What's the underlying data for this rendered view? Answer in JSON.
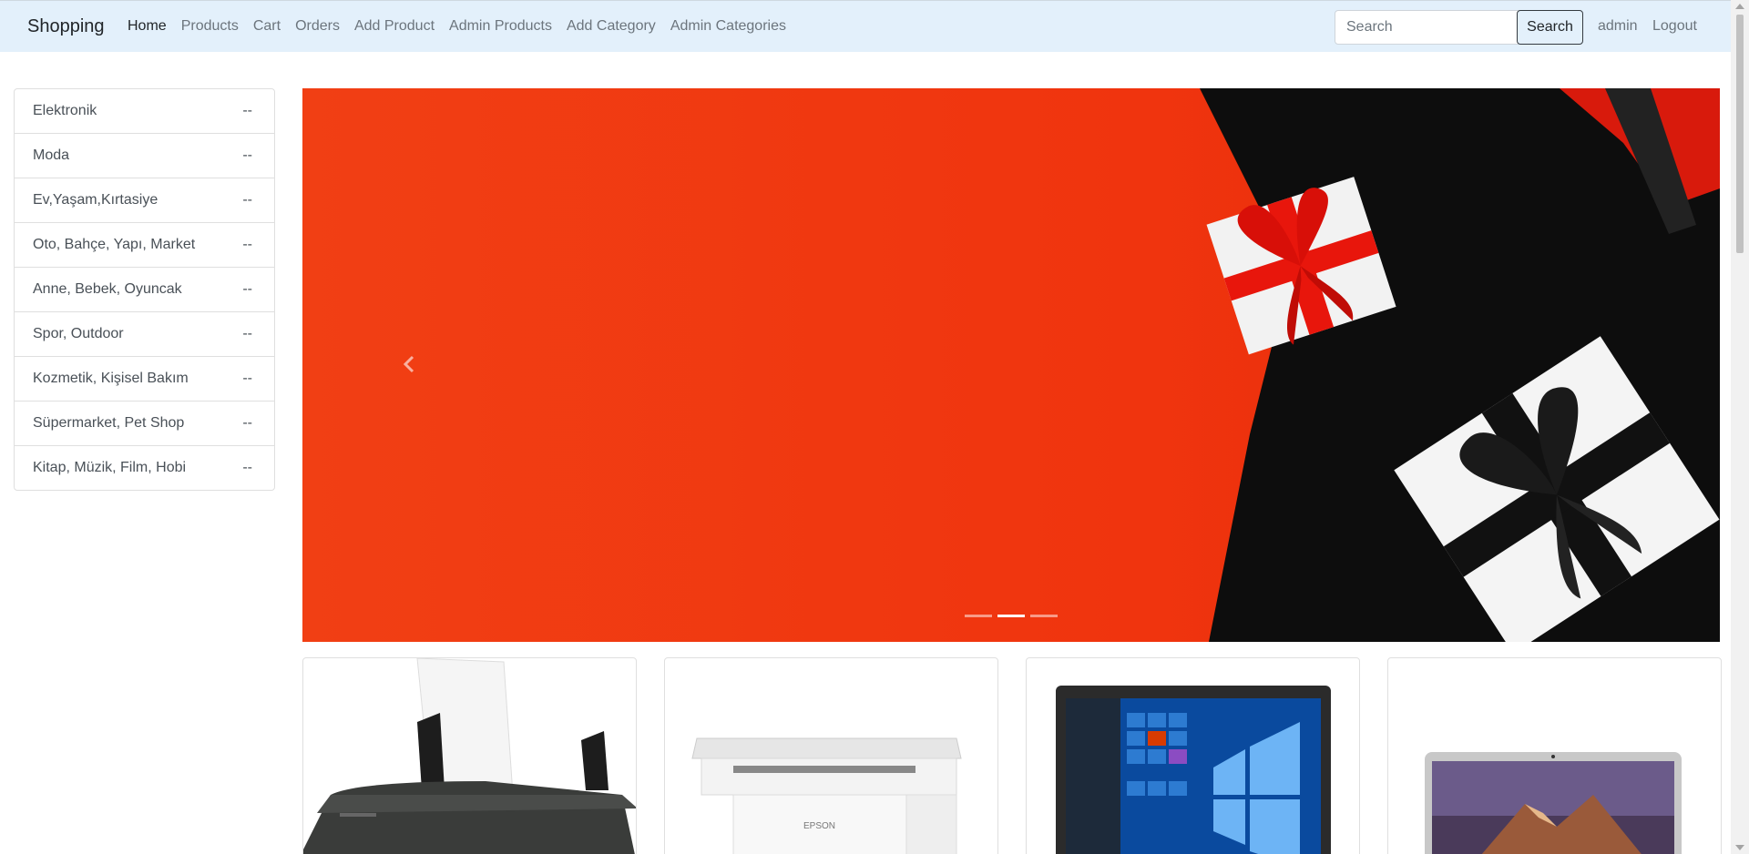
{
  "navbar": {
    "brand": "Shopping",
    "links": [
      {
        "label": "Home",
        "active": true
      },
      {
        "label": "Products",
        "active": false
      },
      {
        "label": "Cart",
        "active": false
      },
      {
        "label": "Orders",
        "active": false
      },
      {
        "label": "Add Product",
        "active": false
      },
      {
        "label": "Admin Products",
        "active": false
      },
      {
        "label": "Add Category",
        "active": false
      },
      {
        "label": "Admin Categories",
        "active": false
      }
    ],
    "search_placeholder": "Search",
    "search_button": "Search",
    "user": "admin",
    "logout": "Logout"
  },
  "categories": [
    {
      "name": "Elektronik",
      "badge": "--"
    },
    {
      "name": "Moda",
      "badge": "--"
    },
    {
      "name": "Ev,Yaşam,Kırtasiye",
      "badge": "--"
    },
    {
      "name": "Oto, Bahçe, Yapı, Market",
      "badge": "--"
    },
    {
      "name": "Anne, Bebek, Oyuncak",
      "badge": "--"
    },
    {
      "name": "Spor, Outdoor",
      "badge": "--"
    },
    {
      "name": "Kozmetik, Kişisel Bakım",
      "badge": "--"
    },
    {
      "name": "Süpermarket, Pet Shop",
      "badge": "--"
    },
    {
      "name": "Kitap, Müzik, Film, Hobi",
      "badge": "--"
    }
  ],
  "carousel": {
    "slide_count": 3,
    "active_index": 1,
    "prev_icon": "chevron-left-icon"
  },
  "products": [
    {
      "image": "inkjet-printer-image"
    },
    {
      "image": "epson-laser-printer-image",
      "brand_text": "EPSON"
    },
    {
      "image": "windows-laptop-image"
    },
    {
      "image": "macbook-image"
    }
  ],
  "colors": {
    "navbar_bg": "#e3f0fb",
    "carousel_red": "#f03a12",
    "carousel_black": "#0d0d0d"
  }
}
